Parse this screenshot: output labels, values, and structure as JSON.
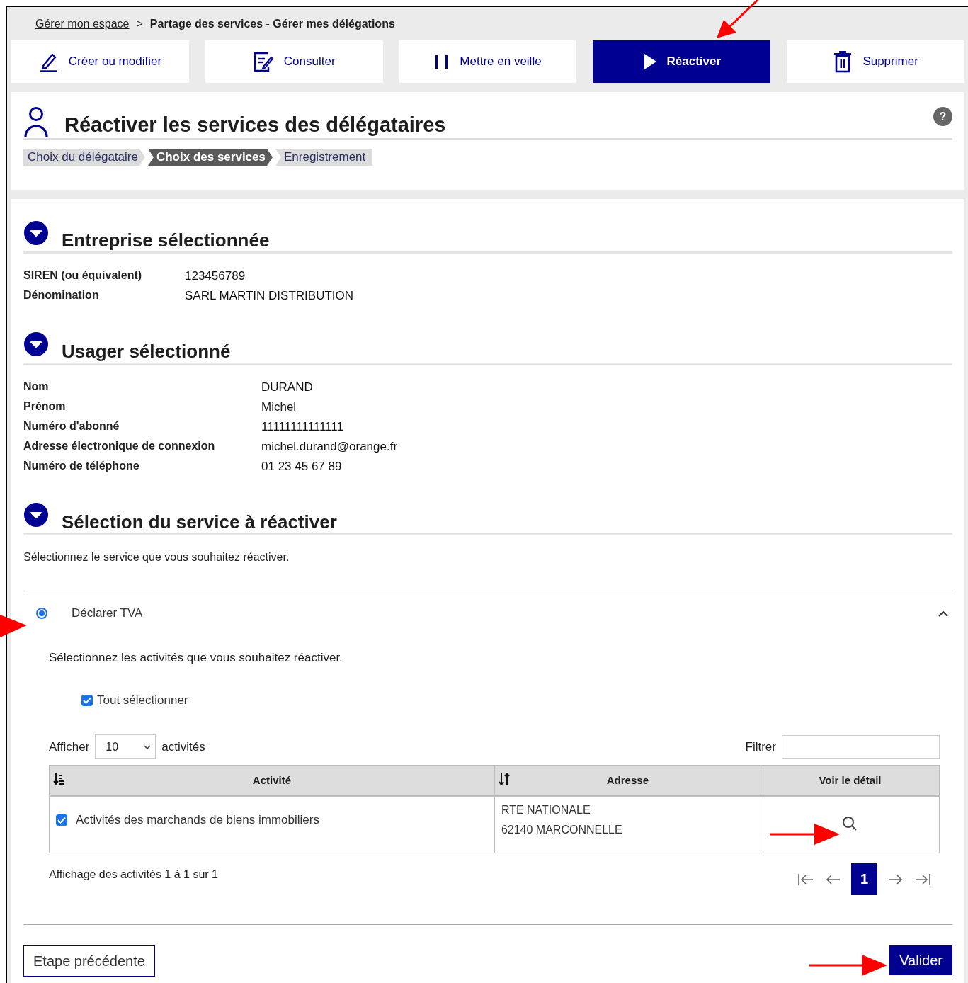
{
  "breadcrumb": [
    {
      "label": "Gérer mon espace",
      "kind": "link"
    },
    {
      "label": ">",
      "kind": "separator"
    },
    {
      "label": "Partage des services - Gérer mes délégations",
      "kind": "current"
    }
  ],
  "tabs": [
    {
      "label": "Créer ou modifier",
      "selected": false
    },
    {
      "label": "Consulter",
      "selected": false
    },
    {
      "label": "Mettre en veille",
      "selected": false
    },
    {
      "label": "Réactiver",
      "selected": true
    },
    {
      "label": "Supprimer",
      "selected": false
    }
  ],
  "page_title": "Réactiver les services des délégataires",
  "help": "?",
  "steps": [
    {
      "label": "Choix du délégataire",
      "selected": false
    },
    {
      "label": "Choix des services",
      "selected": true
    },
    {
      "label": "Enregistrement",
      "selected": false
    }
  ],
  "sections": [
    {
      "title": "Entreprise sélectionnée",
      "fields": [
        {
          "label": "SIREN (ou équivalent)",
          "value": "123456789"
        },
        {
          "label": "Dénomination",
          "value": "SARL MARTIN DISTRIBUTION"
        }
      ]
    },
    {
      "title": "Usager sélectionné",
      "fields": [
        {
          "label": "Nom",
          "value": "DURAND"
        },
        {
          "label": "Prénom",
          "value": "Michel"
        },
        {
          "label": "Numéro d'abonné",
          "value": "11111111111111"
        },
        {
          "label": "Adresse électronique de connexion",
          "value": "michel.durand@orange.fr"
        },
        {
          "label": "Numéro de téléphone",
          "value": "01 23 45 67 89"
        }
      ]
    },
    {
      "title": "Sélection du service à réactiver",
      "instruction": "Sélectionnez le service que vous souhaitez réactiver."
    }
  ],
  "service": {
    "label": "Déclarer TVA",
    "selected": true,
    "expanded": true,
    "instruction": "Sélectionnez les activités que vous souhaitez réactiver.",
    "select_all": {
      "label": "Tout sélectionner",
      "checked": true
    },
    "page_size": {
      "label_before": "Afficher",
      "value": "10",
      "label_after": "activités"
    },
    "filter": {
      "label": "Filtrer"
    },
    "table": {
      "columns": [
        "Activité",
        "Adresse",
        "Voir le détail"
      ],
      "rows": [
        {
          "activity": "Activités des marchands de biens immobiliers",
          "checked": true,
          "address": [
            "RTE NATIONALE",
            "62140 MARCONNELLE"
          ]
        }
      ]
    },
    "summary": "Affichage des activités 1 à 1 sur 1",
    "pages": [
      {
        "label": "1",
        "selected": true
      }
    ]
  },
  "buttons": {
    "back": "Etape précédente",
    "submit": "Valider"
  }
}
